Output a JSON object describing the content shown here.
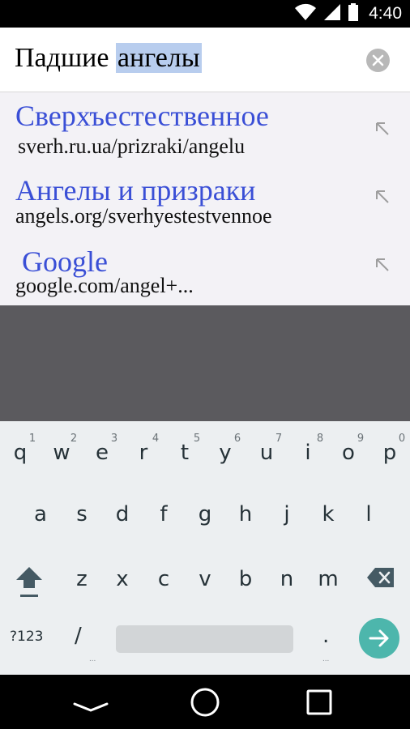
{
  "status_bar": {
    "time": "4:40",
    "icons": [
      "wifi-icon",
      "signal-icon",
      "battery-icon"
    ]
  },
  "omnibox": {
    "query_prefix": "Падшие ",
    "query_selected": "ангелы",
    "clear_icon": "close-circle-icon"
  },
  "suggestions": [
    {
      "title": "Сверхъестественное",
      "url": "sverh.ru.ua/prizraki/angelu"
    },
    {
      "title": "Ангелы и призраки",
      "url": "angels.org/sverhyestestvennoe"
    },
    {
      "title": "Google",
      "url": "google.com/angel+..."
    }
  ],
  "keyboard": {
    "row1": [
      "q",
      "w",
      "e",
      "r",
      "t",
      "y",
      "u",
      "i",
      "o",
      "p"
    ],
    "row1_hints": [
      "1",
      "2",
      "3",
      "4",
      "5",
      "6",
      "7",
      "8",
      "9",
      "0"
    ],
    "row2": [
      "a",
      "s",
      "d",
      "f",
      "g",
      "h",
      "j",
      "k",
      "l"
    ],
    "row3": [
      "z",
      "x",
      "c",
      "v",
      "b",
      "n",
      "m"
    ],
    "symbols_label": "?123",
    "slash_label": "/",
    "period_label": ".",
    "dots_label": "...",
    "accent_color": "#4db6ac"
  },
  "navbar": {
    "icons": [
      "back-icon",
      "home-icon",
      "recents-icon"
    ]
  }
}
